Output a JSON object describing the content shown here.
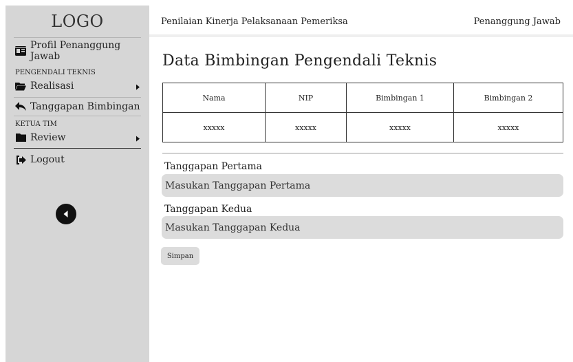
{
  "sidebar": {
    "logo": "LOGO",
    "items": [
      {
        "label": "Profil Penanggung Jawab",
        "icon": "id-card-icon"
      },
      {
        "label": "Realisasi",
        "icon": "folder-open-icon"
      },
      {
        "label": "Tanggapan Bimbingan",
        "icon": "reply-icon"
      },
      {
        "label": "Review",
        "icon": "folder-icon"
      },
      {
        "label": "Logout",
        "icon": "logout-icon"
      }
    ],
    "sections": [
      "PENGENDALI TEKNIS",
      "KETUA TIM"
    ]
  },
  "header": {
    "title": "Penilaian Kinerja Pelaksanaan Pemeriksa",
    "user_role": "Penanggung Jawab"
  },
  "main": {
    "title": "Data Bimbingan Pengendali Teknis",
    "table": {
      "columns": [
        "Nama",
        "NIP",
        "Bimbingan 1",
        "Bimbingan 2"
      ],
      "rows": [
        [
          "xxxxx",
          "xxxxx",
          "xxxxx",
          "xxxxx"
        ]
      ]
    },
    "form": {
      "first_label": "Tanggapan Pertama",
      "first_placeholder": "Masukan Tanggapan Pertama",
      "second_label": "Tanggapan Kedua",
      "second_placeholder": "Masukan Tanggapan Kedua",
      "save_label": "Simpan"
    }
  },
  "colors": {
    "sidebar_bg": "#d6d6d6",
    "input_bg": "#dcdcdc",
    "text": "#222222"
  }
}
